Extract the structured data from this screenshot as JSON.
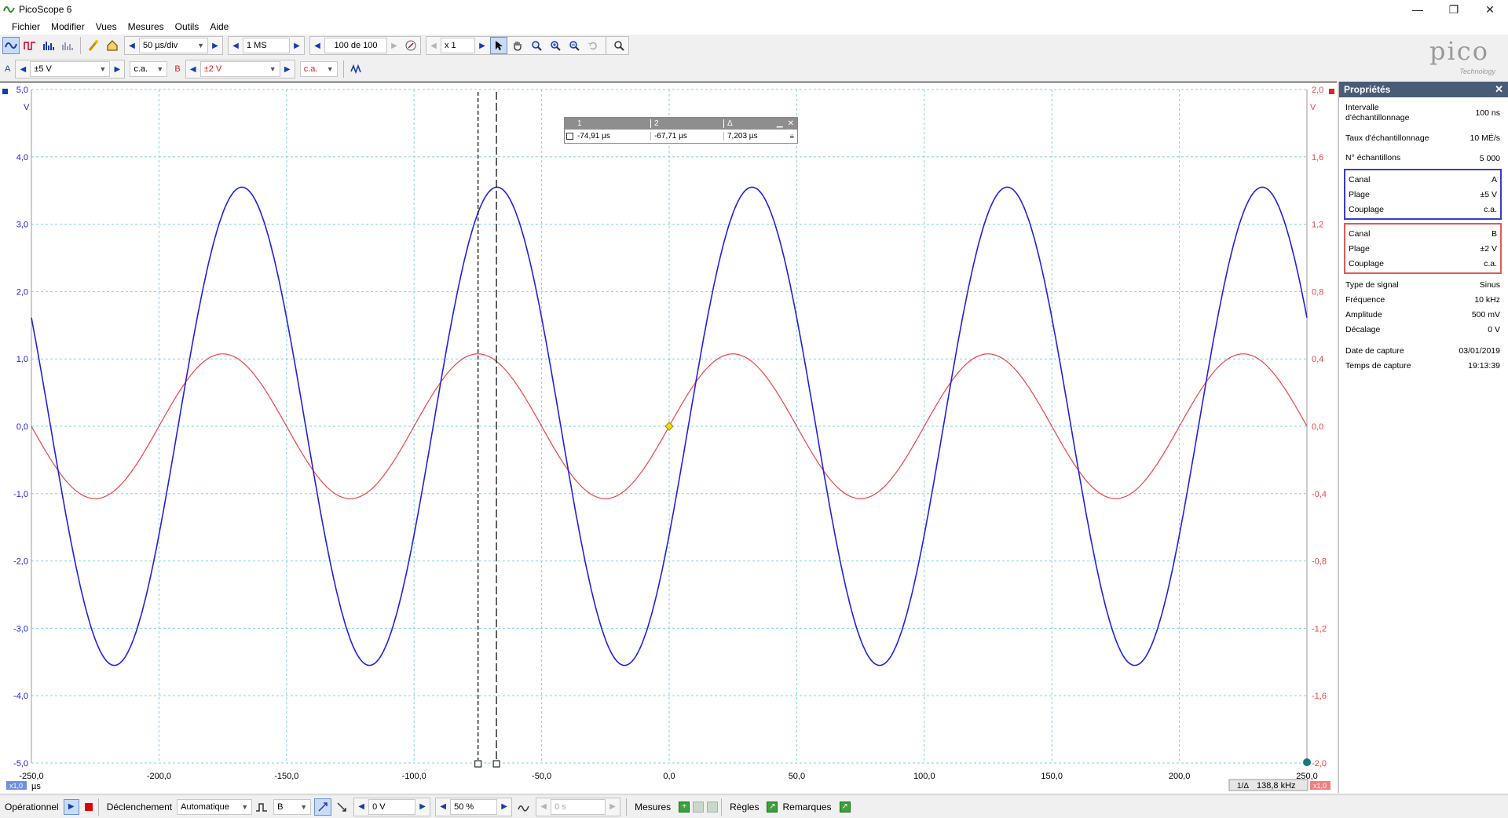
{
  "window": {
    "title": "PicoScope 6",
    "minimize": "—",
    "restore": "❐",
    "close": "✕"
  },
  "menu": [
    "Fichier",
    "Modifier",
    "Vues",
    "Mesures",
    "Outils",
    "Aide"
  ],
  "toolbar1": {
    "timebase": "50 µs/div",
    "samples": "1 MS",
    "buffer": "100 de 100",
    "zoom": "x 1"
  },
  "toolbar2": {
    "channel_a": {
      "label": "A",
      "range": "±5 V",
      "coupling": "c.a."
    },
    "channel_b": {
      "label": "B",
      "range": "±2 V",
      "coupling": "c.a."
    }
  },
  "logo": {
    "word": "pico",
    "sub": "Technology"
  },
  "scope": {
    "x_ticks": [
      "-250,0",
      "-200,0",
      "-150,0",
      "-100,0",
      "-50,0",
      "0,0",
      "50,0",
      "100,0",
      "150,0",
      "200,0",
      "250,0"
    ],
    "x_unit": "µs",
    "left_ticks": [
      "5,0",
      "4,0",
      "3,0",
      "2,0",
      "1,0",
      "0,0",
      "-1,0",
      "-2,0",
      "-3,0",
      "-4,0",
      "-5,0"
    ],
    "left_unit": "V",
    "right_ticks": [
      "2,0",
      "1,6",
      "1,2",
      "0,8",
      "0,4",
      "0,0",
      "-0,4",
      "-0,8",
      "-1,2",
      "-1,6",
      "-2,0"
    ],
    "right_unit": "V",
    "zoom_left": "x1,0",
    "zoom_right": "x1,0",
    "freq_readout": "138,8 kHz",
    "freq_label": "1/Δ",
    "colors": {
      "channel_a": "#2222dd",
      "channel_b": "#ee4444",
      "grid": "#7fd3e8"
    }
  },
  "chart_data": {
    "type": "line",
    "xlabel": "µs",
    "ylabel": "V",
    "xlim": [
      -250,
      250
    ],
    "ylim": [
      -5,
      5
    ],
    "y2lim": [
      -2,
      2
    ],
    "series": [
      {
        "name": "A",
        "axis": "left",
        "amplitude": 3.55,
        "frequency_hz": 10000,
        "phase_zero_crossing_us": 7.5
      },
      {
        "name": "B",
        "axis": "right",
        "amplitude": 0.43,
        "frequency_hz": 10000,
        "phase_zero_crossing_us": 0
      }
    ],
    "cursors_us": [
      -74.91,
      -67.71
    ]
  },
  "cursors": {
    "header": [
      "1",
      "2",
      "Δ"
    ],
    "values": [
      "-74,91 µs",
      "-67,71 µs",
      "7,203 µs"
    ]
  },
  "properties": {
    "title": "Propriétés",
    "top": [
      {
        "label": "Intervalle d'échantillonnage",
        "value": "100 ns"
      },
      {
        "label": "Taux d'échantillonnage",
        "value": "10 MÉ/s"
      },
      {
        "label": "N° échantillons",
        "value": "5 000"
      }
    ],
    "channel_a": [
      {
        "label": "Canal",
        "value": "A"
      },
      {
        "label": "Plage",
        "value": "±5 V"
      },
      {
        "label": "Couplage",
        "value": "c.a."
      }
    ],
    "channel_b": [
      {
        "label": "Canal",
        "value": "B"
      },
      {
        "label": "Plage",
        "value": "±2 V"
      },
      {
        "label": "Couplage",
        "value": "c.a."
      }
    ],
    "signal": [
      {
        "label": "Type de signal",
        "value": "Sinus"
      },
      {
        "label": "Fréquence",
        "value": "10 kHz"
      },
      {
        "label": "Amplitude",
        "value": "500 mV"
      },
      {
        "label": "Décalage",
        "value": "0 V"
      }
    ],
    "capture": [
      {
        "label": "Date de capture",
        "value": "03/01/2019"
      },
      {
        "label": "Temps de capture",
        "value": "19:13:39"
      }
    ]
  },
  "status": {
    "mode": "Opérationnel",
    "trigger_label": "Déclenchement",
    "trigger_mode": "Automatique",
    "trigger_source": "B",
    "trigger_level": "0 V",
    "pre_trigger": "50 %",
    "delay": "0 s",
    "measures": "Mesures",
    "rules": "Règles",
    "remarks": "Remarques"
  }
}
